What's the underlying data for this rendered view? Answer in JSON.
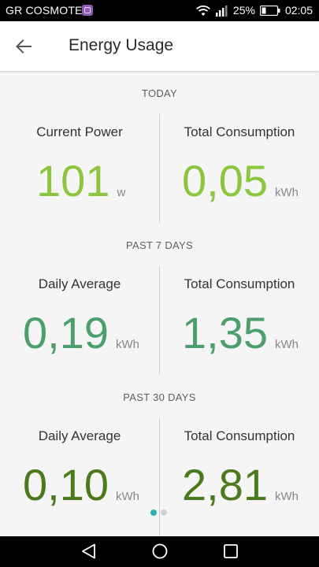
{
  "status_bar": {
    "carrier": "GR COSMOTE",
    "battery": "25%",
    "time": "02:05"
  },
  "app_bar": {
    "title": "Energy Usage"
  },
  "sections": [
    {
      "header": "TODAY",
      "left": {
        "label": "Current Power",
        "value": "101",
        "unit": "w"
      },
      "right": {
        "label": "Total Consumption",
        "value": "0,05",
        "unit": "kWh"
      }
    },
    {
      "header": "PAST 7 DAYS",
      "left": {
        "label": "Daily Average",
        "value": "0,19",
        "unit": "kWh"
      },
      "right": {
        "label": "Total Consumption",
        "value": "1,35",
        "unit": "kWh"
      }
    },
    {
      "header": "PAST 30 DAYS",
      "left": {
        "label": "Daily Average",
        "value": "0,10",
        "unit": "kWh"
      },
      "right": {
        "label": "Total Consumption",
        "value": "2,81",
        "unit": "kWh"
      }
    }
  ],
  "colors": {
    "today": "#8cc63f",
    "past7": "#4c9e6a",
    "past30": "#4a7a1c",
    "pager_active": "#29b0b0"
  },
  "pager": {
    "pages": 2,
    "current": 1
  }
}
